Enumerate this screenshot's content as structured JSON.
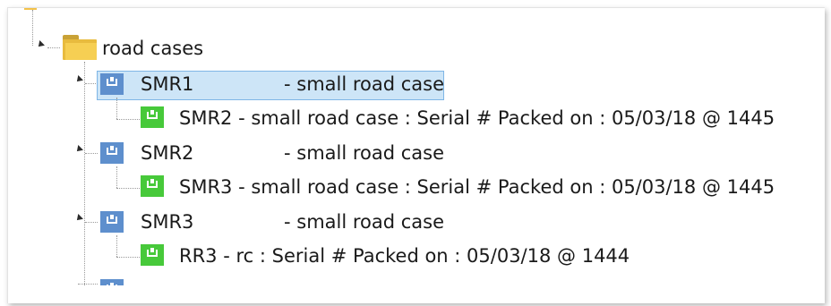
{
  "tree": {
    "root": {
      "label": "road cases"
    },
    "items": [
      {
        "name": "SMR1",
        "desc": "- small road case",
        "selected": true,
        "child": {
          "label": "SMR2 - small road case : Serial # Packed on : 05/03/18 @ 1445"
        }
      },
      {
        "name": "SMR2",
        "desc": "- small road case",
        "selected": false,
        "child": {
          "label": "SMR3 - small road case : Serial # Packed on : 05/03/18 @ 1445"
        }
      },
      {
        "name": "SMR3",
        "desc": "- small road case",
        "selected": false,
        "child": {
          "label": "RR3 - rc : Serial # Packed on : 05/03/18 @ 1444"
        }
      }
    ]
  },
  "colors": {
    "selection_fill": "#cde5f7",
    "selection_border": "#7fb6e6",
    "parent_case_icon": "#5e8fcd",
    "child_case_icon": "#47c93a",
    "folder_icon": "#f6cf53"
  },
  "icons": {
    "root": "folder-icon",
    "parent": "road-case-icon",
    "child": "packed-case-icon",
    "expander": "expanded-triangle-icon"
  }
}
